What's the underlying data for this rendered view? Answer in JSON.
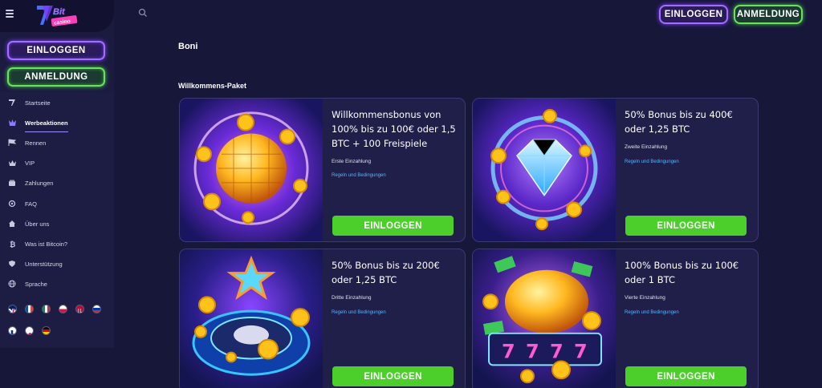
{
  "header": {
    "logo_text": "Bit casino",
    "login_label": "EINLOGGEN",
    "register_label": "ANMELDUNG"
  },
  "sidebar": {
    "login_label": "EINLOGGEN",
    "register_label": "ANMELDUNG",
    "items": [
      {
        "label": "Startseite",
        "icon": "home-logo-icon"
      },
      {
        "label": "Werbeaktionen",
        "icon": "promotions-icon"
      },
      {
        "label": "Rennen",
        "icon": "race-flag-icon"
      },
      {
        "label": "VIP",
        "icon": "crown-icon"
      },
      {
        "label": "Zahlungen",
        "icon": "wallet-icon"
      },
      {
        "label": "FAQ",
        "icon": "faq-icon"
      },
      {
        "label": "Über uns",
        "icon": "house-icon"
      },
      {
        "label": "Was ist Bitcoin?",
        "icon": "bitcoin-icon"
      },
      {
        "label": "Unterstützung",
        "icon": "shield-icon"
      },
      {
        "label": "Sprache",
        "icon": "globe-icon"
      }
    ],
    "active_index": 1,
    "flags": [
      "uk",
      "france",
      "italy",
      "poland",
      "norway",
      "russia",
      "finland",
      "japan",
      "germany"
    ]
  },
  "main": {
    "title": "Boni",
    "section_title": "Willkommens-Paket",
    "cards": [
      {
        "title": "Willkommensbonus von 100% bis zu 100€ oder 1,5 BTC + 100 Freispiele",
        "deposit": "Erste Einzahlung",
        "terms": "Regeln und Bedingungen",
        "button": "EINLOGGEN",
        "art": "disco-ball"
      },
      {
        "title": "50% Bonus bis zu 400€ oder 1,25 BTC",
        "deposit": "Zweite Einzahlung",
        "terms": "Regeln und Bedingungen",
        "button": "EINLOGGEN",
        "art": "diamond"
      },
      {
        "title": "50% Bonus bis zu 200€ oder 1,25 BTC",
        "deposit": "Dritte Einzahlung",
        "terms": "Regeln und Bedingungen",
        "button": "EINLOGGEN",
        "art": "roulette"
      },
      {
        "title": "100% Bonus bis zu 100€ oder 1 BTC",
        "deposit": "Vierte Einzahlung",
        "terms": "Regeln und Bedingungen",
        "button": "EINLOGGEN",
        "art": "slot-777"
      }
    ]
  },
  "colors": {
    "background": "#17173a",
    "login_border": "#a46cff",
    "register_border": "#6be05a",
    "card_button": "#4ccf2a",
    "terms_link": "#53b5ff"
  }
}
